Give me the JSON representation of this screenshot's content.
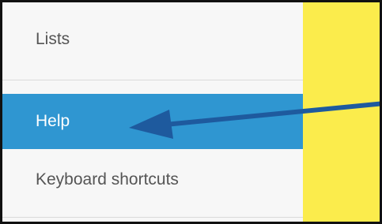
{
  "menu": {
    "items": [
      {
        "label": "Lists",
        "selected": false
      },
      {
        "label": "Help",
        "selected": true
      },
      {
        "label": "Keyboard shortcuts",
        "selected": false
      }
    ]
  },
  "colors": {
    "selected_background": "#2f96d1",
    "annotation_panel": "#fbec4c",
    "arrow": "#1e5a9e",
    "text_default": "#555555"
  },
  "icons": {
    "annotation": "pointer-arrow-icon"
  }
}
